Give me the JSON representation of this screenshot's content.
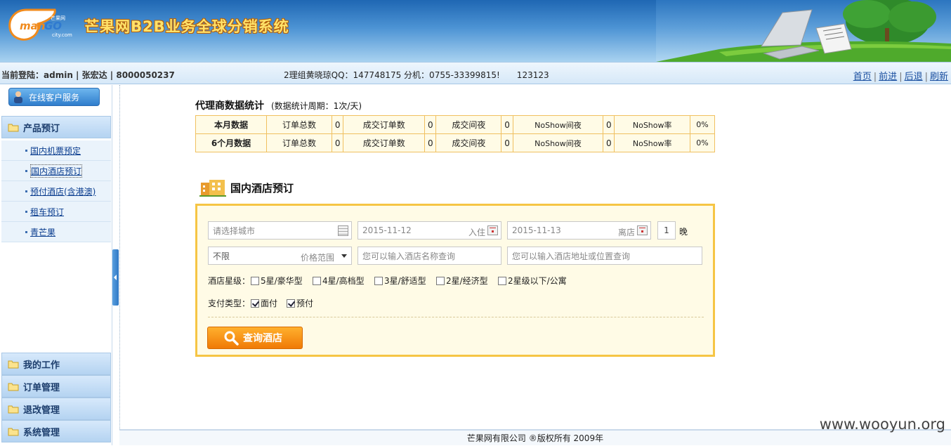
{
  "header": {
    "logo_text": "mangocity.com",
    "logo_brand": "芒果网",
    "system_title": "芒果网B2B业务全球分销系统"
  },
  "infobar": {
    "login_label": "当前登陆：",
    "login_value": "admin | 张宏达 | 8000050237",
    "contact": "2理组黄晓琼QQ：147748175 分机：0755-33399815!　　123123",
    "nav": [
      "首页",
      "前进",
      "后退",
      "刷新"
    ]
  },
  "sidebar": {
    "service_button": "在线客户服务",
    "sections": {
      "product": "产品预订",
      "mywork": "我的工作",
      "orders": "订单管理",
      "refund": "退改管理",
      "system": "系统管理"
    },
    "sub_items": [
      "国内机票预定",
      "国内酒店预订",
      "预付酒店(含港澳)",
      "租车预订",
      "青芒果"
    ]
  },
  "stats": {
    "title": "代理商数据统计",
    "period": "(数据统计周期：1次/天)",
    "col_labels": [
      "订单总数",
      "成交订单数",
      "成交间夜",
      "NoShow间夜",
      "NoShow率"
    ],
    "rows": [
      {
        "name": "本月数据",
        "values": [
          "0",
          "0",
          "0",
          "0",
          "0%"
        ]
      },
      {
        "name": "6个月数据",
        "values": [
          "0",
          "0",
          "0",
          "0",
          "0%"
        ]
      }
    ]
  },
  "hotel_search": {
    "title": "国内酒店预订",
    "city_placeholder": "请选择城市",
    "checkin_date": "2015-11-12",
    "checkin_label": "入住",
    "checkout_date": "2015-11-13",
    "checkout_label": "离店",
    "nights": "1",
    "nights_label": "晚",
    "price_value": "不限",
    "price_label": "价格范围",
    "name_placeholder": "您可以输入酒店名称查询",
    "address_placeholder": "您可以输入酒店地址或位置查询",
    "star_label": "酒店星级：",
    "star_options": [
      {
        "label": "5星/豪华型",
        "checked": false
      },
      {
        "label": "4星/高档型",
        "checked": false
      },
      {
        "label": "3星/舒适型",
        "checked": false
      },
      {
        "label": "2星/经济型",
        "checked": false
      },
      {
        "label": "2星级以下/公寓",
        "checked": false
      }
    ],
    "pay_label": "支付类型：",
    "pay_options": [
      {
        "label": "面付",
        "checked": true
      },
      {
        "label": "预付",
        "checked": true
      }
    ],
    "search_button": "查询酒店"
  },
  "footer": {
    "copyright": "芒果网有限公司 ®版权所有 2009年"
  },
  "watermark": "www.wooyun.org"
}
